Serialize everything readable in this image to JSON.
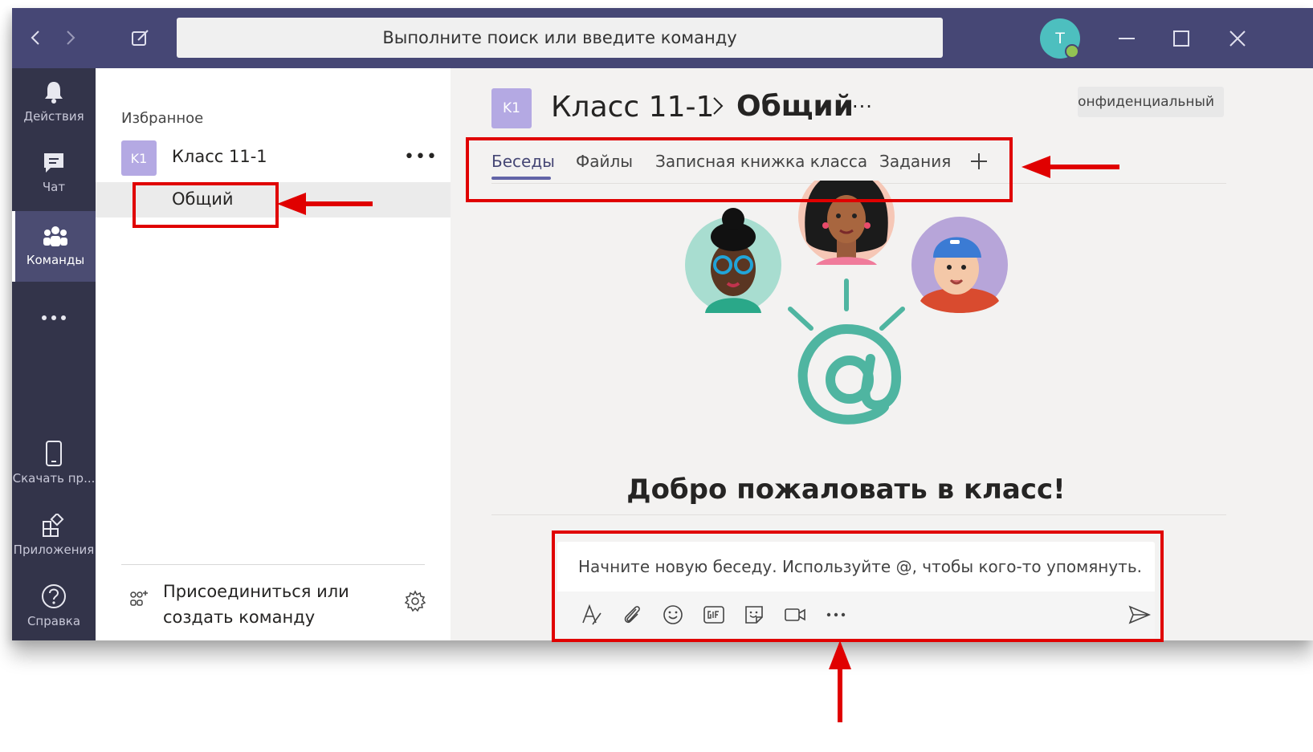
{
  "titlebar": {
    "search_placeholder": "Выполните поиск или введите команду",
    "avatar_initial": "T"
  },
  "rail": {
    "items": [
      {
        "label": "Действия",
        "icon": "bell-icon"
      },
      {
        "label": "Чат",
        "icon": "chat-icon"
      },
      {
        "label": "Команды",
        "icon": "teams-icon",
        "active": true
      },
      {
        "label": "Скачать пр...",
        "icon": "mobile-icon"
      },
      {
        "label": "Приложения",
        "icon": "apps-icon"
      },
      {
        "label": "Справка",
        "icon": "help-icon"
      }
    ]
  },
  "pane": {
    "favorites_label": "Избранное",
    "team": {
      "initials": "K1",
      "name": "Класс 11-1"
    },
    "channel": "Общий",
    "join_label": "Присоединиться или создать команду"
  },
  "main": {
    "team_initials": "K1",
    "breadcrumb_team": "Класс 11-1",
    "breadcrumb_channel": "Общий",
    "badge": "Конфиденциальный",
    "tabs": [
      "Беседы",
      "Файлы",
      "Записная книжка класса",
      "Задания"
    ],
    "welcome": "Добро пожаловать в класс!",
    "compose_placeholder": "Начните новую беседу. Используйте @, чтобы кого-то упомянуть."
  },
  "colors": {
    "titlebar": "#464775",
    "rail": "#33344a",
    "accent": "#6264a7",
    "tile": "#b4a9e3",
    "annotation": "#e00000",
    "illustration": "#4fb5a1"
  }
}
